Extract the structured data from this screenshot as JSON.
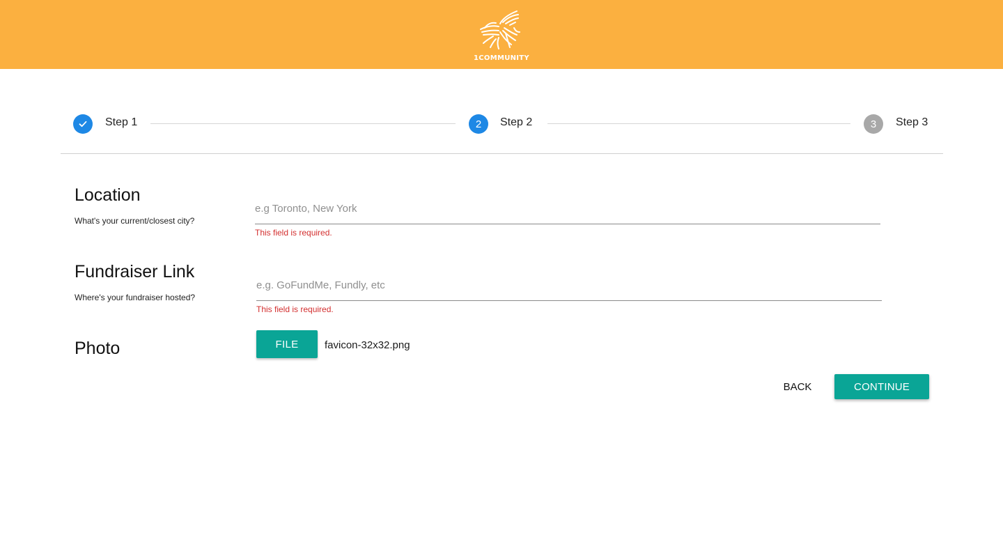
{
  "brand": {
    "name": "1COMMUNITY",
    "header_color": "#fbb040",
    "accent_color": "#0aa596",
    "step_active_color": "#1e88e5"
  },
  "stepper": {
    "steps": [
      {
        "number": "",
        "label": "Step 1",
        "state": "completed",
        "icon": "check-icon"
      },
      {
        "number": "2",
        "label": "Step 2",
        "state": "active"
      },
      {
        "number": "3",
        "label": "Step 3",
        "state": "inactive"
      }
    ]
  },
  "form": {
    "location": {
      "title": "Location",
      "subtitle": "What's your current/closest city?",
      "placeholder": "e.g Toronto, New York",
      "value": "",
      "error": "This field is required."
    },
    "fundraiser": {
      "title": "Fundraiser Link",
      "subtitle": "Where's your fundraiser hosted?",
      "placeholder": "e.g. GoFundMe, Fundly, etc",
      "value": "",
      "error": "This field is required."
    },
    "photo": {
      "title": "Photo",
      "button_label": "FILE",
      "file_name": "favicon-32x32.png"
    }
  },
  "actions": {
    "back_label": "BACK",
    "continue_label": "CONTINUE"
  }
}
